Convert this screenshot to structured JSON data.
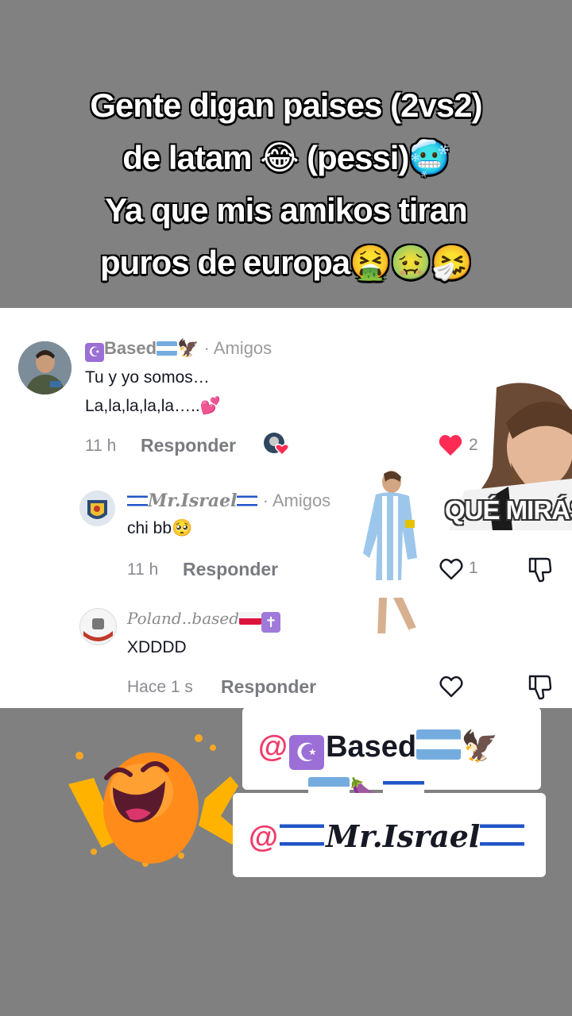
{
  "caption": {
    "line1": "Gente digan paises (2vs2)",
    "line2": "de latam 😂 (pessi)🥶",
    "line3": "Ya que mis amikos tiran",
    "line4": "puros de europa🤮🤢🤧"
  },
  "comments": [
    {
      "username": "Based",
      "relation": "· Amigos",
      "text_line1": "Tu y yo somos…",
      "text_line2": "La,la,la,la,la…..💕",
      "time": "11 h",
      "reply_label": "Responder",
      "like_count": "2",
      "liked": true,
      "creator_liked": true
    },
    {
      "username": "Mr.Israel",
      "relation": "· Amigos",
      "text": "chi bb🥺",
      "time": "11 h",
      "reply_label": "Responder",
      "like_count": "1",
      "liked": false
    },
    {
      "username": "Poland..based",
      "text": "XDDDD",
      "time": "Hace 1 s",
      "reply_label": "Responder",
      "like_count": "",
      "liked": false
    }
  ],
  "sticker_text": "QUÉ MIRÁS B",
  "mentions": [
    {
      "at": "@",
      "name": "Based"
    },
    {
      "at": "@",
      "name": "Mr.Israel"
    }
  ],
  "mention_emoji_line": "🍆",
  "colors": {
    "accent_heart": "#fe2c55",
    "mention_at": "#ef3d69",
    "bg_gray": "#808080",
    "panel_white": "#ffffff"
  },
  "icons": [
    "heart-icon",
    "thumb-down-icon",
    "crescent-icon",
    "eagle-icon",
    "latin-cross-icon"
  ]
}
